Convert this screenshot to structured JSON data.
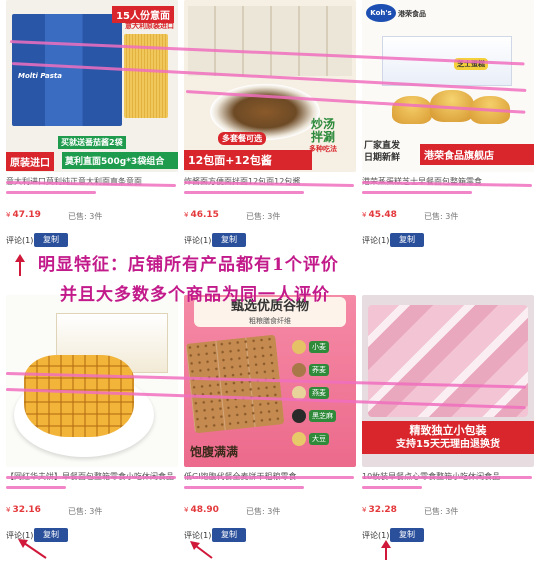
{
  "products": [
    {
      "banner_top": "15人份意面",
      "banner_sub": "意大利原装进口",
      "brand_pack": "Molti Pasta",
      "gift_text": "买就送番茄酱2袋",
      "label_left": "原装进口",
      "label_right": "莫利直面500g*3袋组合",
      "title": "意大利进口莫利纯正意大利面直条意面",
      "price": "47.19",
      "currency": "¥",
      "sold": "已售: 3件",
      "review": "评论(1)",
      "copy_label": "复制"
    },
    {
      "brand_pack": "拌面",
      "side_tag": "多套餐可选",
      "stamp_line1": "炒汤",
      "stamp_line2": "拌涮",
      "stamp_line3": "多种吃法",
      "label_main": "12包面+12包酱",
      "title": "炸酱面方便面拌面12包面12包酱",
      "price": "46.15",
      "currency": "¥",
      "sold": "已售: 3件",
      "review": "评论(1)",
      "copy_label": "复制"
    },
    {
      "logo": "Koh's",
      "logo_sub": "港荣食品",
      "cake_label": "芝士蛋糕",
      "label_left": "厂家直发",
      "label_left2": "日期新鲜",
      "label_right": "港荣食品旗舰店",
      "title": "港荣蒸蛋糕芝士早餐面包整箱零食",
      "price": "45.48",
      "currency": "¥",
      "sold": "已售: 3件",
      "review": "评论(1)",
      "copy_label": "复制"
    },
    {
      "title": "【网红华夫饼】早餐面包整箱零食小吃休闲食品",
      "price": "32.16",
      "currency": "¥",
      "sold": "已售: 3件",
      "review": "评论(1)",
      "copy_label": "复制"
    },
    {
      "heading": "甄选优质谷物",
      "subheading": "粗粮膳食纤维",
      "ingredients": [
        "小麦",
        "荞麦",
        "燕麦",
        "黑芝麻",
        "大豆"
      ],
      "footer": "饱腹满满",
      "title": "低GI饱腹代餐全麦饼干粗粮零食",
      "price": "48.90",
      "currency": "¥",
      "sold": "已售: 3件",
      "review": "评论(1)",
      "copy_label": "复制"
    },
    {
      "label_line1": "精致独立小包装",
      "label_line2": "支持15天无理由退换货",
      "title": "10枚装早餐点心零食整箱小吃休闲食品",
      "price": "32.28",
      "currency": "¥",
      "sold": "已售: 3件",
      "review": "评论(1)",
      "copy_label": "复制"
    }
  ],
  "annotation": {
    "line1": "明显特征：店铺所有产品都有1个评价",
    "line2": "并且大多数多个商品为同一人评价"
  },
  "colors": {
    "accent_red": "#e4393c",
    "copy_button": "#2a4f9b",
    "annotation": "#c21a8a",
    "scribble": "#f06ebe"
  }
}
